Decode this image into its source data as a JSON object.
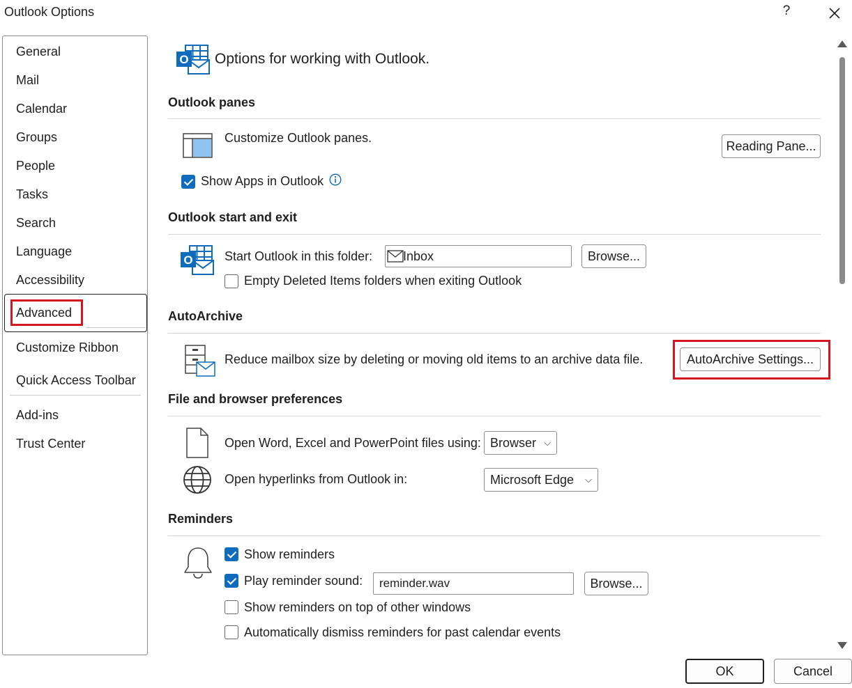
{
  "window": {
    "title": "Outlook Options",
    "help": "?"
  },
  "sidebar": {
    "items": [
      {
        "label": "General"
      },
      {
        "label": "Mail"
      },
      {
        "label": "Calendar"
      },
      {
        "label": "Groups"
      },
      {
        "label": "People"
      },
      {
        "label": "Tasks"
      },
      {
        "label": "Search"
      },
      {
        "label": "Language"
      },
      {
        "label": "Accessibility"
      },
      {
        "label": "Advanced",
        "selected": true
      },
      {
        "label": "Customize Ribbon"
      },
      {
        "label": "Quick Access Toolbar"
      },
      {
        "label": "Add-ins"
      },
      {
        "label": "Trust Center"
      }
    ]
  },
  "main": {
    "heading": "Options for working with Outlook.",
    "panes": {
      "title": "Outlook panes",
      "description": "Customize Outlook panes.",
      "reading_pane_button": "Reading Pane...",
      "show_apps_label": "Show Apps in Outlook",
      "show_apps_checked": true
    },
    "start_exit": {
      "title": "Outlook start and exit",
      "start_folder_label": "Start Outlook in this folder:",
      "start_folder_value": "Inbox",
      "browse_button": "Browse...",
      "empty_deleted_label": "Empty Deleted Items folders when exiting Outlook",
      "empty_deleted_checked": false
    },
    "autoarchive": {
      "title": "AutoArchive",
      "description": "Reduce mailbox size by deleting or moving old items to an archive data file.",
      "settings_button": "AutoArchive Settings..."
    },
    "file_browser": {
      "title": "File and browser preferences",
      "open_files_label": "Open Word, Excel and PowerPoint files using:",
      "open_files_value": "Browser",
      "hyperlinks_label": "Open hyperlinks from Outlook in:",
      "hyperlinks_value": "Microsoft Edge"
    },
    "reminders": {
      "title": "Reminders",
      "show_reminders_label": "Show reminders",
      "show_reminders_checked": true,
      "play_sound_label": "Play reminder sound:",
      "play_sound_checked": true,
      "sound_file": "reminder.wav",
      "browse_button": "Browse...",
      "on_top_label": "Show reminders on top of other windows",
      "on_top_checked": false,
      "auto_dismiss_label": "Automatically dismiss reminders for past calendar events",
      "auto_dismiss_checked": false
    }
  },
  "footer": {
    "ok": "OK",
    "cancel": "Cancel"
  },
  "colors": {
    "accent": "#0f6cbd",
    "highlight": "#d4161f",
    "outlook_blue": "#0f6cbd"
  }
}
